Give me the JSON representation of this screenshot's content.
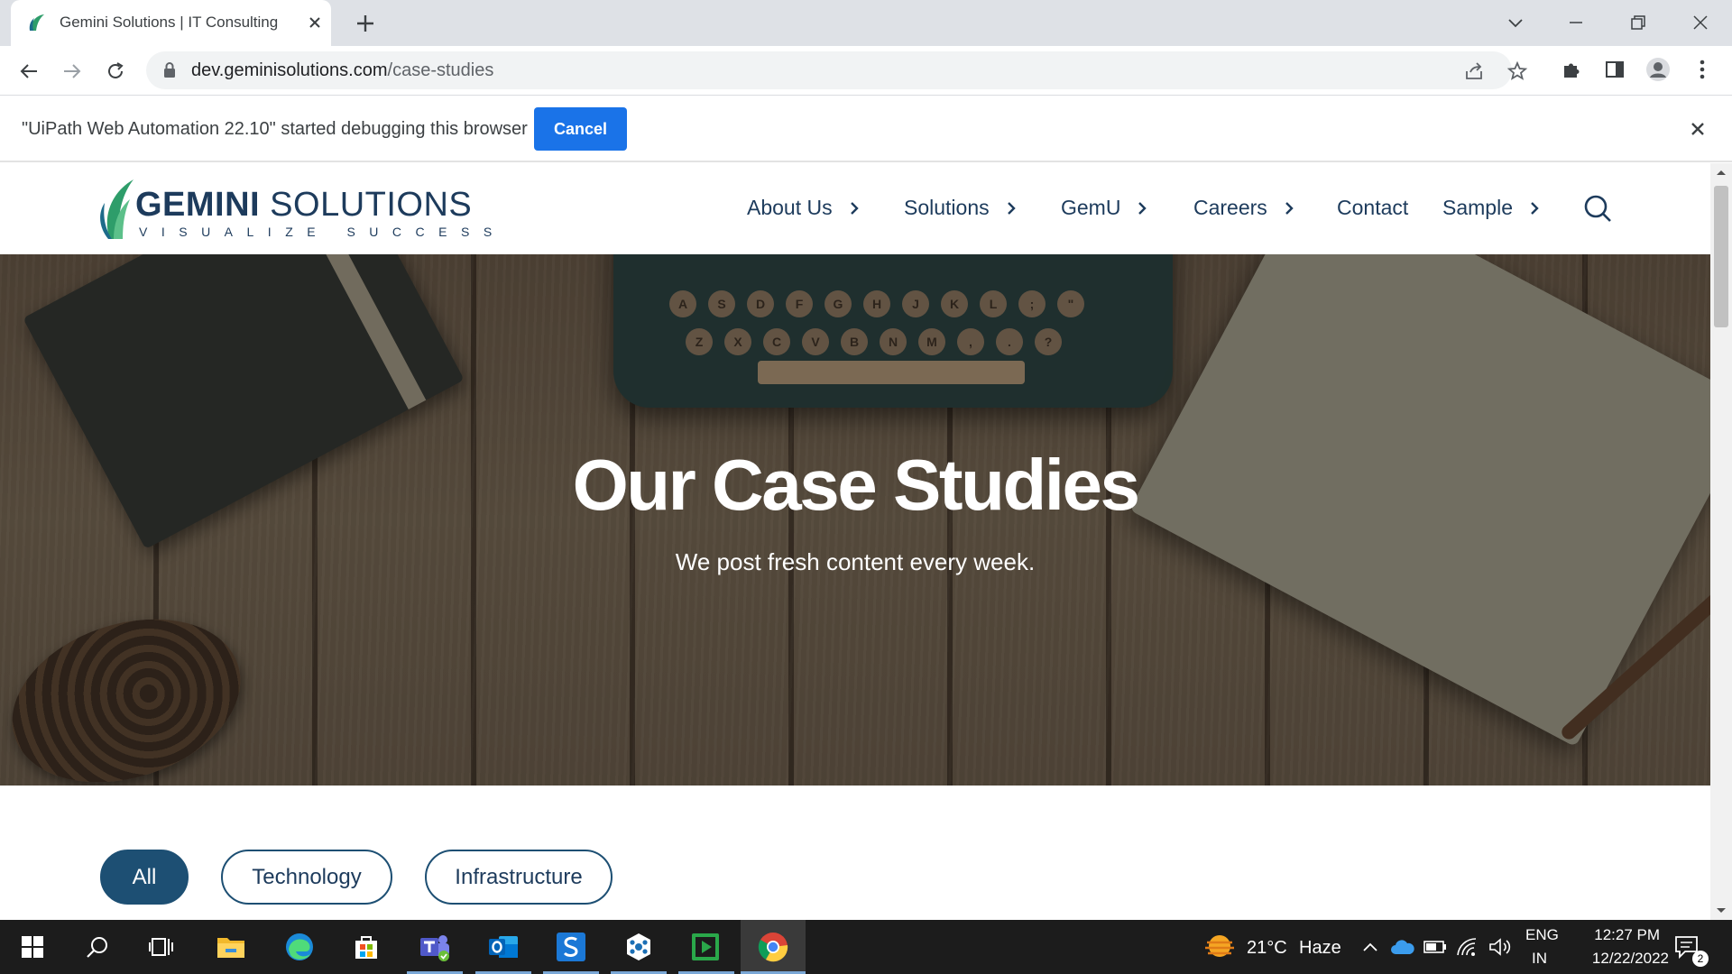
{
  "browser": {
    "tab_title": "Gemini Solutions | IT Consulting",
    "url_host": "dev.geminisolutions.com",
    "url_path": "/case-studies"
  },
  "infobar": {
    "message": "\"UiPath Web Automation 22.10\" started debugging this browser",
    "cancel_label": "Cancel"
  },
  "site": {
    "logo_name_bold": "GEMINI",
    "logo_name_rest": " SOLUTIONS",
    "logo_tagline": "VISUALIZE SUCCESS",
    "nav": [
      {
        "label": "About Us"
      },
      {
        "label": "Solutions"
      },
      {
        "label": "GemU"
      },
      {
        "label": "Careers"
      },
      {
        "label": "Contact"
      },
      {
        "label": "Sample"
      }
    ],
    "hero_title": "Our Case Studies",
    "hero_subtitle": "We post fresh content every week.",
    "hero_keys_row1": [
      "A",
      "S",
      "D",
      "F",
      "G",
      "H",
      "J",
      "K",
      "L",
      ";",
      "\""
    ],
    "hero_keys_row2": [
      "Z",
      "X",
      "C",
      "V",
      "B",
      "N",
      "M",
      ",",
      ".",
      "?"
    ],
    "filters": [
      {
        "label": "All",
        "active": true
      },
      {
        "label": "Technology",
        "active": false
      },
      {
        "label": "Infrastructure",
        "active": false
      }
    ]
  },
  "taskbar": {
    "weather_temp": "21°C",
    "weather_cond": "Haze",
    "lang_top": "ENG",
    "lang_bottom": "IN",
    "time": "12:27 PM",
    "date": "12/22/2022",
    "notification_count": "2"
  },
  "colors": {
    "brand_navy": "#1d3b5c",
    "filter_active": "#1d4f73",
    "chrome_blue": "#1a73e8"
  }
}
